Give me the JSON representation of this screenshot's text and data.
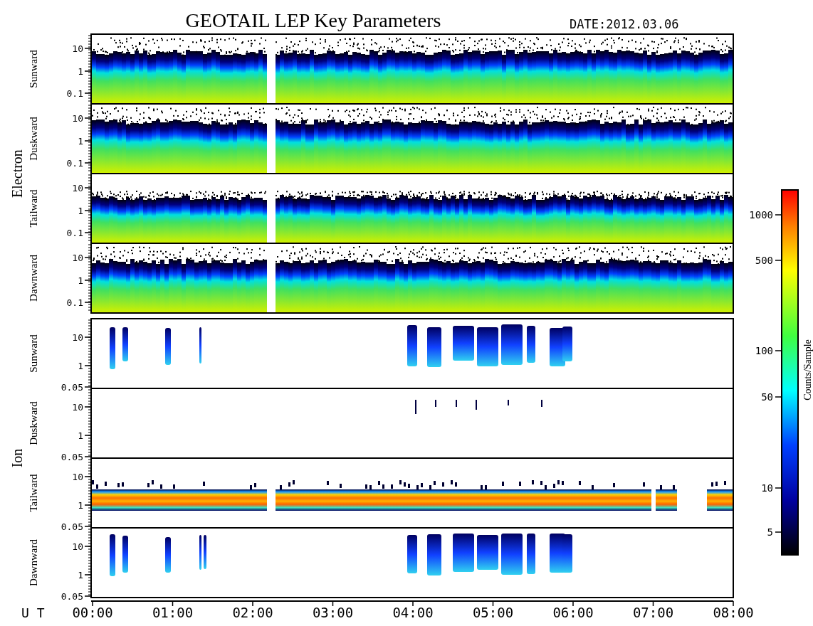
{
  "title": "GEOTAIL LEP Key Parameters",
  "date": "DATE:2012.03.06",
  "groups": [
    {
      "label": "Electron",
      "kind": "electron",
      "panels": [
        {
          "label": "Sunward",
          "yticks": [
            "10",
            "1",
            "0.1"
          ]
        },
        {
          "label": "Duskward",
          "yticks": [
            "10",
            "1",
            "0.1"
          ]
        },
        {
          "label": "Tailward",
          "yticks": [
            "10",
            "1",
            "0.1"
          ]
        },
        {
          "label": "Dawnward",
          "yticks": [
            "10",
            "1",
            "0.1"
          ]
        }
      ]
    },
    {
      "label": "Ion",
      "kind": "ion",
      "panels": [
        {
          "label": "Sunward",
          "yticks": [
            "10",
            "1",
            "0.05"
          ]
        },
        {
          "label": "Duskward",
          "yticks": [
            "10",
            "1",
            "0.05"
          ]
        },
        {
          "label": "Tailward",
          "yticks": [
            "10",
            "1",
            "0.05"
          ]
        },
        {
          "label": "Dawnward",
          "yticks": [
            "10",
            "1",
            "0.05"
          ]
        }
      ]
    }
  ],
  "time_axis": {
    "label": "U T",
    "ticks": [
      "00:00",
      "01:00",
      "02:00",
      "03:00",
      "04:00",
      "05:00",
      "06:00",
      "07:00",
      "08:00"
    ]
  },
  "colorbar": {
    "label": "Counts/Sample",
    "ticks": [
      "1000",
      "500",
      "100",
      "50",
      "10",
      "5"
    ]
  }
}
